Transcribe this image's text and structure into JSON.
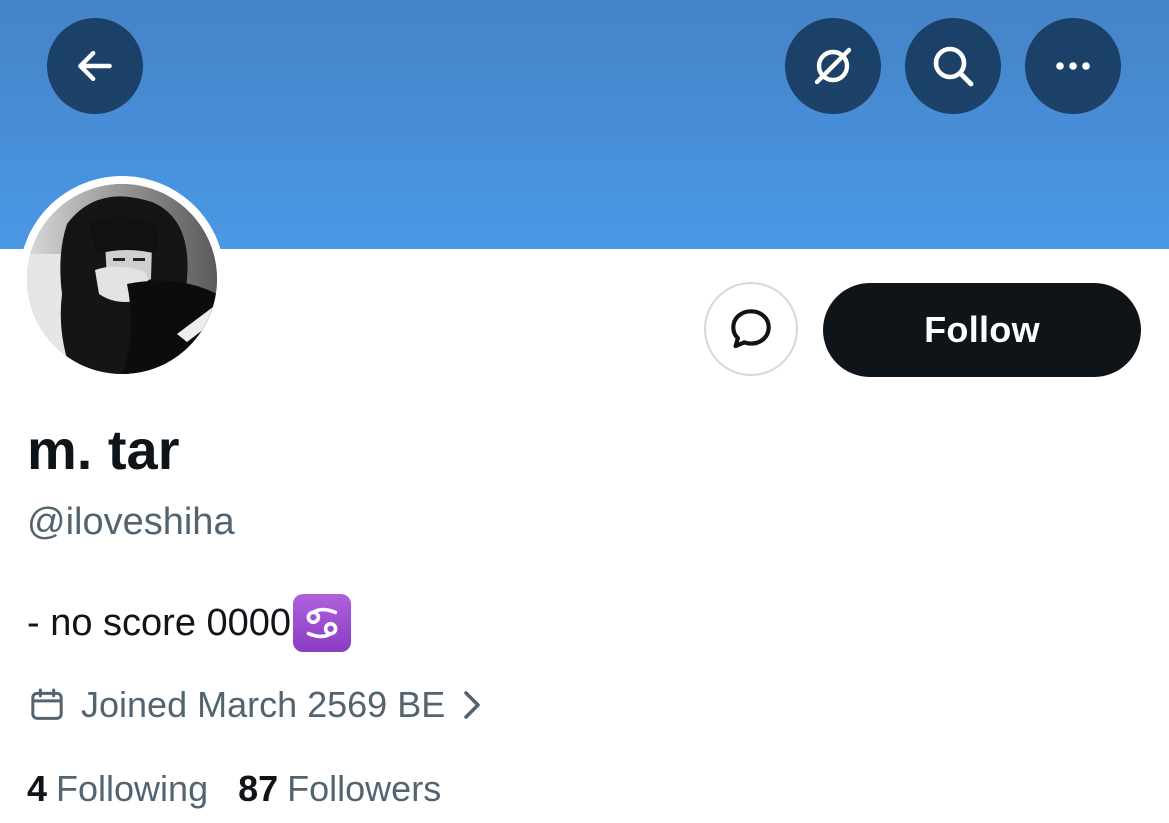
{
  "header": {
    "back_icon": "arrow-left-icon",
    "grok_icon": "grok-icon",
    "search_icon": "search-icon",
    "more_icon": "more-horizontal-icon",
    "banner_color": "#4a98e6"
  },
  "profile": {
    "display_name": "m. tar",
    "handle": "@iloveshiha",
    "bio": "- no score 0000",
    "bio_emoji": "cancer-zodiac-emoji",
    "joined": "Joined March 2569 BE",
    "following_count": "4",
    "following_label": "Following",
    "followers_count": "87",
    "followers_label": "Followers"
  },
  "actions": {
    "message_icon": "message-bubble-icon",
    "follow_label": "Follow"
  },
  "colors": {
    "text_primary": "#0f1419",
    "text_secondary": "#536471",
    "follow_bg": "#0f1419",
    "zodiac_bg": "#9b4fd1"
  }
}
